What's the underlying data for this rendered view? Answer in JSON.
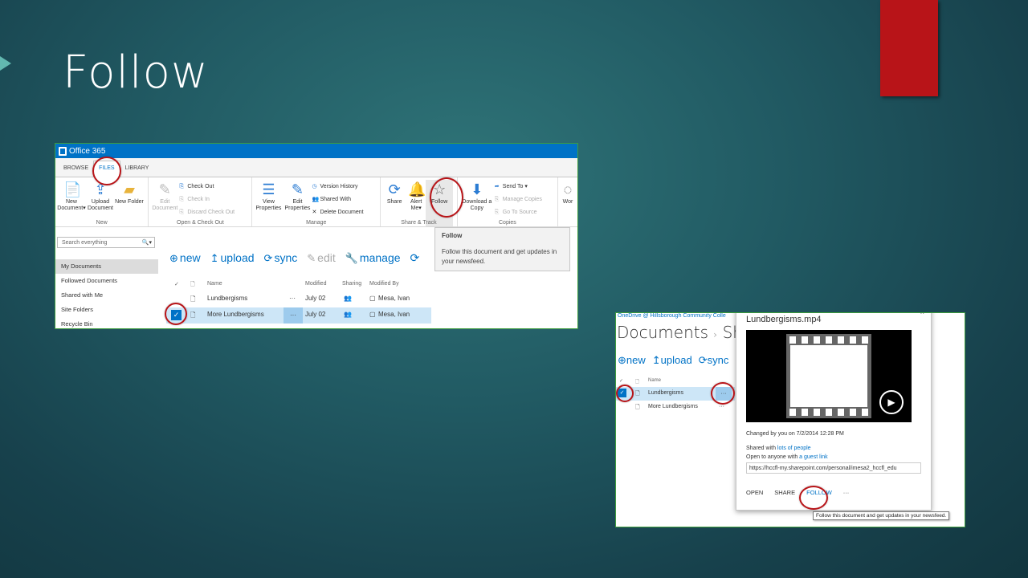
{
  "slide": {
    "title": "Follow"
  },
  "shot1": {
    "app_name": "Office 365",
    "tabs": [
      {
        "label": "BROWSE"
      },
      {
        "label": "FILES"
      },
      {
        "label": "LIBRARY"
      }
    ],
    "ribbon": {
      "new_group": {
        "label": "New",
        "new_document": "New Document",
        "new_document_arrow": "▾",
        "upload_document": "Upload Document",
        "new_folder": "New Folder"
      },
      "open_group": {
        "label": "Open & Check Out",
        "edit_document": "Edit Document",
        "check_out": "Check Out",
        "check_in": "Check In",
        "discard_check_out": "Discard Check Out"
      },
      "manage_group": {
        "label": "Manage",
        "view_properties": "View Properties",
        "edit_properties": "Edit Properties",
        "version_history": "Version History",
        "shared_with": "Shared With",
        "delete_document": "Delete Document"
      },
      "share_group": {
        "label": "Share & Track",
        "share": "Share",
        "alert_me": "Alert Me",
        "alert_arrow": "▾",
        "follow": "Follow"
      },
      "copies_group": {
        "label": "Copies",
        "download_copy": "Download a Copy",
        "send_to": "Send To",
        "send_to_arrow": "▾",
        "manage_copies": "Manage Copies",
        "go_to_source": "Go To Source"
      },
      "overflow": "Wor"
    },
    "tooltip": {
      "title": "Follow",
      "text": "Follow this document and get updates in your newsfeed."
    },
    "search": {
      "placeholder": "Search everything",
      "icon": "🔍",
      "arrow": "▾"
    },
    "nav": [
      {
        "label": "My Documents"
      },
      {
        "label": "Followed Documents"
      },
      {
        "label": "Shared with Me"
      },
      {
        "label": "Site Folders"
      },
      {
        "label": "Recycle Bin"
      }
    ],
    "commands": {
      "new": "new",
      "upload": "upload",
      "sync": "sync",
      "edit": "edit",
      "manage": "manage"
    },
    "columns": {
      "check": "✓",
      "name": "Name",
      "modified": "Modified",
      "sharing": "Sharing",
      "modified_by": "Modified By"
    },
    "rows": [
      {
        "name": "Lundbergisms",
        "ellipsis": "···",
        "modified": "July 02",
        "modified_by": "Mesa, Ivan"
      },
      {
        "name": "More Lundbergisms",
        "ellipsis": "···",
        "modified": "July 02",
        "modified_by": "Mesa, Ivan"
      }
    ]
  },
  "shot2": {
    "breadcrumb": "OneDrive @ Hillsborough Community Colle",
    "title_part1": "Documents",
    "separator": "›",
    "title_part2": "Sha",
    "commands": {
      "new": "new",
      "upload": "upload",
      "sync": "sync"
    },
    "columns": {
      "check": "✓",
      "name": "Name"
    },
    "rows": [
      {
        "name": "Lundbergisms",
        "ellipsis": "···"
      },
      {
        "name": "More Lundbergisms",
        "ellipsis": "···"
      }
    ],
    "callout": {
      "title": "Lundbergisms.mp4",
      "close": "×",
      "changed": "Changed by you on 7/2/2014 12:28 PM",
      "shared_prefix": "Shared with",
      "shared_link": "lots of people",
      "open_prefix": "Open to anyone with",
      "open_link": "a guest link",
      "url": "https://hccfl-my.sharepoint.com/personal/imesa2_hccfl_edu",
      "actions": {
        "open": "OPEN",
        "share": "SHARE",
        "follow": "FOLLOW",
        "more": "···"
      }
    },
    "tooltip": "Follow this document and get updates in your newsfeed."
  }
}
